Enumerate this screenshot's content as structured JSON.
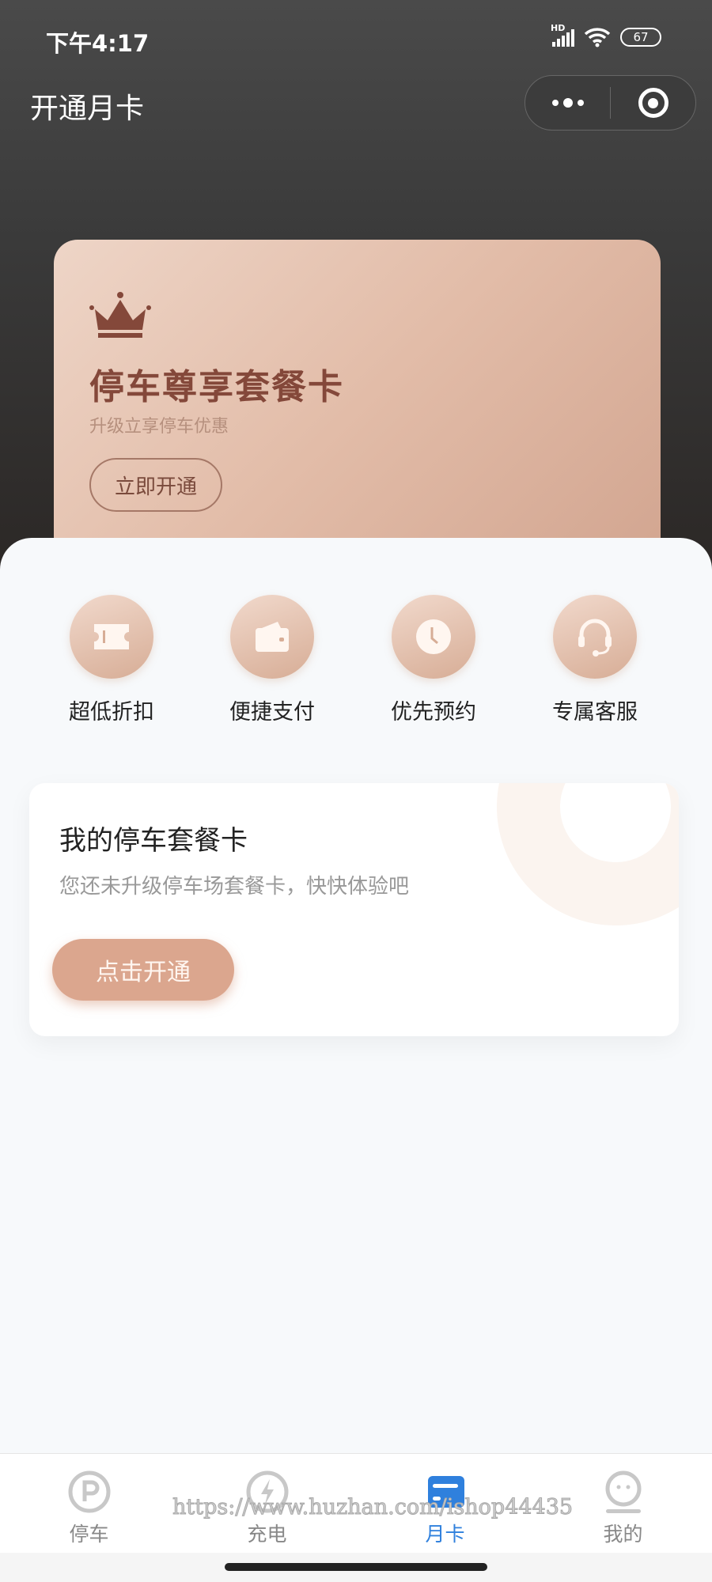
{
  "status_bar": {
    "time": "下午4:17",
    "network": "HD",
    "battery": "67"
  },
  "nav": {
    "title": "开通月卡",
    "more_icon": "more-dots-icon",
    "target_icon": "target-icon"
  },
  "vip_card": {
    "title": "停车尊享套餐卡",
    "subtitle": "升级立享停车优惠",
    "button": "立即开通",
    "icon": "crown-icon"
  },
  "features": [
    {
      "label": "超低折扣",
      "icon": "ticket-icon"
    },
    {
      "label": "便捷支付",
      "icon": "wallet-icon"
    },
    {
      "label": "优先预约",
      "icon": "clock-icon"
    },
    {
      "label": "专属客服",
      "icon": "headset-icon"
    }
  ],
  "my_card": {
    "title": "我的停车套餐卡",
    "subtitle": "您还未升级停车场套餐卡，快快体验吧",
    "button": "点击开通"
  },
  "tabs": [
    {
      "label": "停车",
      "icon": "parking-icon",
      "active": false
    },
    {
      "label": "充电",
      "icon": "lightning-icon",
      "active": false
    },
    {
      "label": "月卡",
      "icon": "card-icon",
      "active": true
    },
    {
      "label": "我的",
      "icon": "profile-icon",
      "active": false
    }
  ],
  "watermark": "https://www.huzhan.com/ishop44435",
  "colors": {
    "accent": "#2f80dd",
    "card_brown": "#84483a",
    "button": "#dba68e"
  }
}
